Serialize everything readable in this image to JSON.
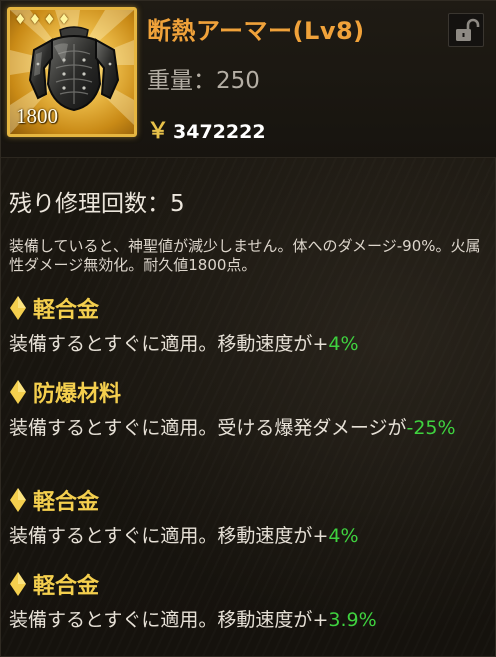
{
  "item": {
    "name": "断熱アーマー(Lv8)",
    "weight_label": "重量",
    "weight_separator": "：",
    "weight_value": "250",
    "currency_symbol": "￥",
    "price": "3472222",
    "durability": "1800",
    "rarity_symbols": [
      "♦",
      "♦",
      "♦",
      "♦"
    ],
    "icon": "body-armor-icon",
    "lock_icon": "unlock-icon"
  },
  "repair": {
    "label": "残り修理回数",
    "separator": "：",
    "value": "5"
  },
  "description": "装備していると、神聖値が減少しません。体へのダメージ-90%。火属性ダメージ無効化。耐久値1800点。",
  "abilities": [
    {
      "name": "軽合金",
      "text": "装備するとすぐに適用。移動速度が",
      "sign": "+",
      "value": "4%"
    },
    {
      "name": "防爆材料",
      "text": "装備するとすぐに適用。受ける爆発ダメージが",
      "sign": "-",
      "value": "25%"
    },
    {
      "name": "軽合金",
      "text": "装備するとすぐに適用。移動速度が",
      "sign": "+",
      "value": "4%"
    },
    {
      "name": "軽合金",
      "text": "装備するとすぐに適用。移動速度が",
      "sign": "+",
      "value": "3.9%"
    }
  ],
  "colors": {
    "frame_gold": "#e6b640",
    "title_orange": "#f0a23a",
    "ability_gold": "#f4cf4e",
    "positive_green": "#3fd23f"
  }
}
